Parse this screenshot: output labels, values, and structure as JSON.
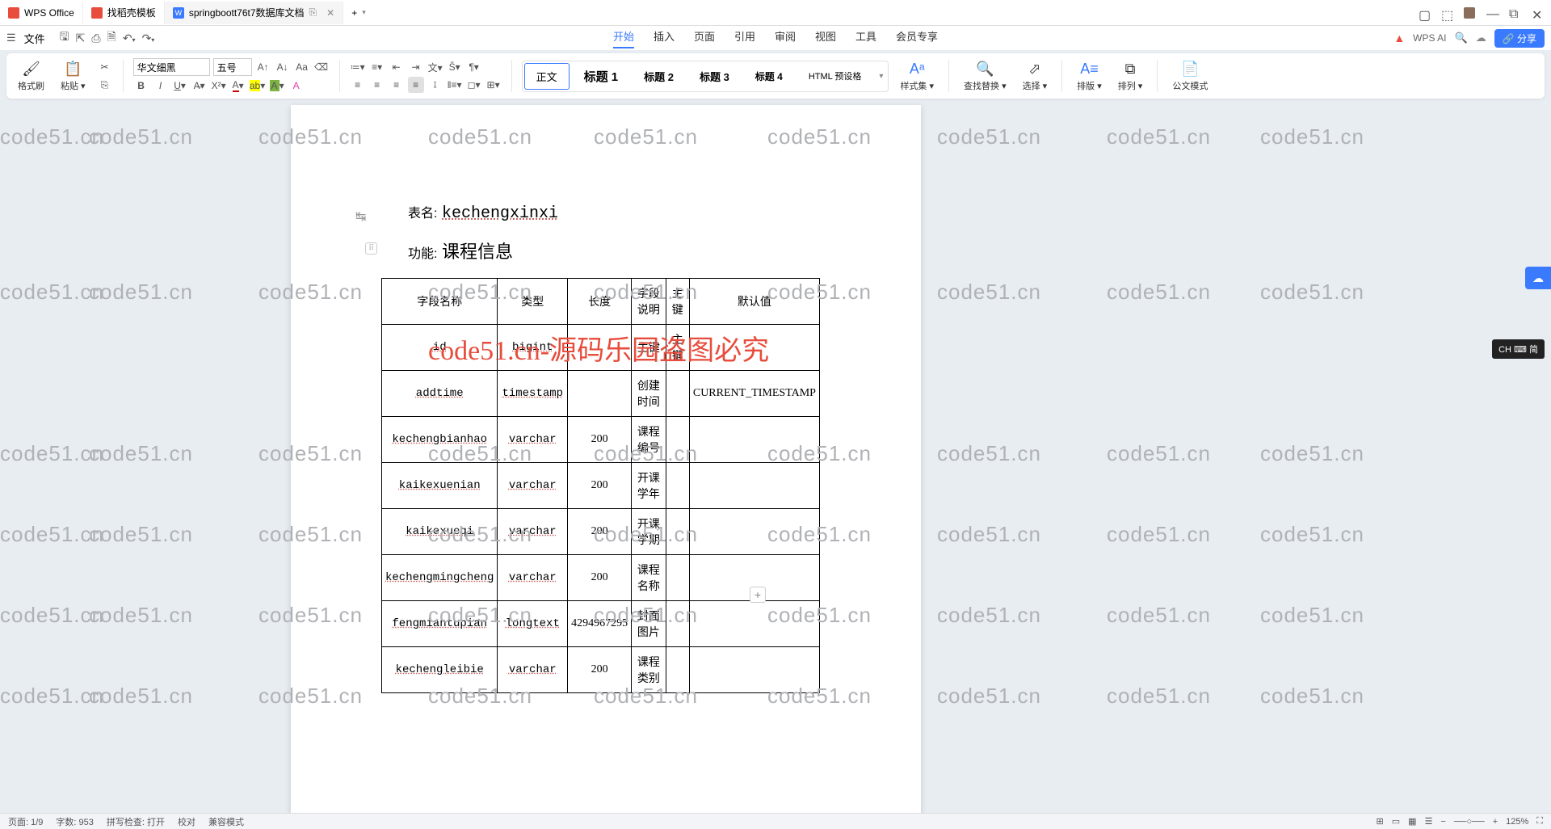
{
  "titlebar": {
    "tabs": [
      {
        "icon_color": "#e74c3c",
        "label": "WPS Office"
      },
      {
        "icon_color": "#e74c3c",
        "label": "找稻壳模板"
      },
      {
        "icon_color": "#3a7afe",
        "label": "springboott76t7数据库文档"
      }
    ],
    "add_tab": "+"
  },
  "menubar": {
    "file_label": "文件",
    "tabs": [
      "开始",
      "插入",
      "页面",
      "引用",
      "审阅",
      "视图",
      "工具",
      "会员专享"
    ],
    "active_tab": "开始",
    "wpsai": "WPS AI",
    "cloud_icon": "☁",
    "share": "分享"
  },
  "ribbon": {
    "format_brush": "格式刷",
    "paste": "粘贴",
    "font_name": "华文细黑",
    "font_size": "五号",
    "styles": [
      "正文",
      "标题 1",
      "标题 2",
      "标题 3",
      "标题 4",
      "HTML 预设格"
    ],
    "style_set": "样式集",
    "find_replace": "查找替换",
    "select": "选择",
    "layout": "排版",
    "arrange": "排列",
    "official_mode": "公文模式"
  },
  "document": {
    "table_name_label": "表名:",
    "table_name_value": "kechengxinxi",
    "function_label": "功能:",
    "function_value": "课程信息",
    "columns": [
      "字段名称",
      "类型",
      "长度",
      "字段说明",
      "主键",
      "默认值"
    ],
    "rows": [
      {
        "c0": "id",
        "c1": "bigint",
        "c2": "",
        "c3": "主键",
        "c4": "主键",
        "c5": ""
      },
      {
        "c0": "addtime",
        "c1": "timestamp",
        "c2": "",
        "c3": "创建时间",
        "c4": "",
        "c5": "CURRENT_TIMESTAMP"
      },
      {
        "c0": "kechengbianhao",
        "c1": "varchar",
        "c2": "200",
        "c3": "课程编号",
        "c4": "",
        "c5": ""
      },
      {
        "c0": "kaikexuenian",
        "c1": "varchar",
        "c2": "200",
        "c3": "开课学年",
        "c4": "",
        "c5": ""
      },
      {
        "c0": "kaikexueqi",
        "c1": "varchar",
        "c2": "200",
        "c3": "开课学期",
        "c4": "",
        "c5": ""
      },
      {
        "c0": "kechengmingcheng",
        "c1": "varchar",
        "c2": "200",
        "c3": "课程名称",
        "c4": "",
        "c5": ""
      },
      {
        "c0": "fengmiantupian",
        "c1": "longtext",
        "c2": "4294967295",
        "c3": "封面图片",
        "c4": "",
        "c5": ""
      },
      {
        "c0": "kechengleibie",
        "c1": "varchar",
        "c2": "200",
        "c3": "课程类别",
        "c4": "",
        "c5": ""
      }
    ]
  },
  "watermark": {
    "domain": "code51.cn",
    "center": "code51.cn-源码乐园盗图必究"
  },
  "ime": "CH ⌨ 简",
  "statusbar": {
    "page": "页面: 1/9",
    "words": "字数: 953",
    "spell": "拼写检查: 打开",
    "proof": "校对",
    "compat": "兼容模式",
    "zoom": "125%"
  }
}
